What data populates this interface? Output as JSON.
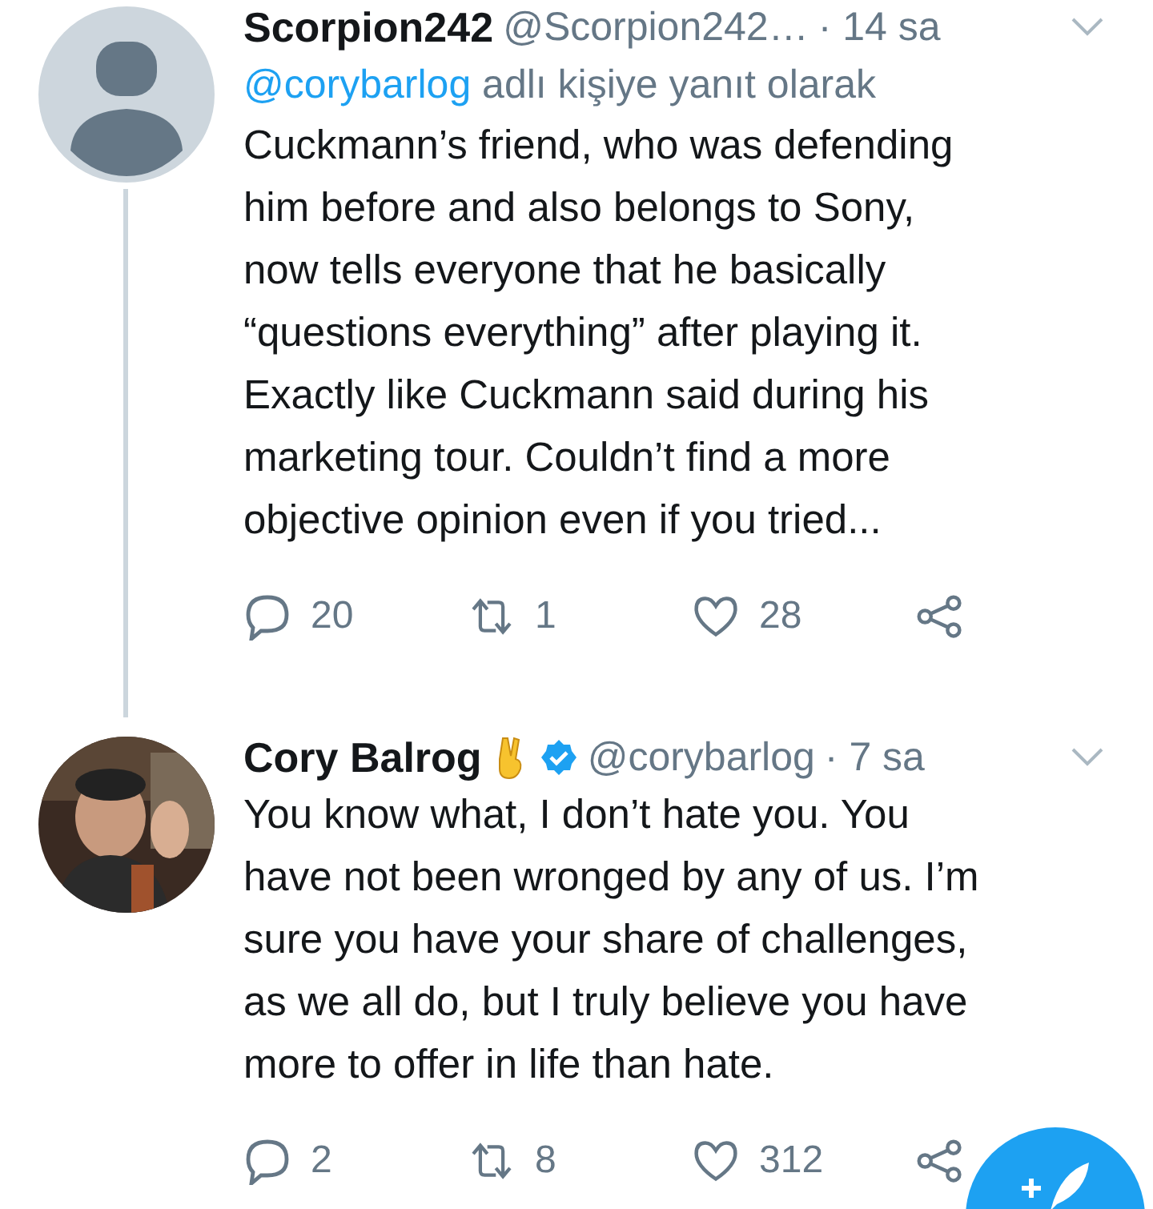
{
  "tweets": [
    {
      "name": "Scorpion242",
      "verified": false,
      "emoji": false,
      "handle": "@Scorpion242…",
      "time": "· 14 sa",
      "reply_prefix": "@corybarlog",
      "reply_suffix": " adlı kişiye yanıt olarak",
      "avatar": {
        "kind": "placeholder"
      },
      "body": "Cuckmann’s friend, who was defending\nhim before and also belongs to Sony,\nnow tells everyone that he basically\n“questions everything” after playing it.\nExactly like Cuckmann said during his\nmarketing tour. Couldn’t find a more\nobjective opinion even if you tried...",
      "replies": "20",
      "retweets": "1",
      "likes": "28",
      "thread_line": true
    },
    {
      "name": "Cory Balrog",
      "verified": true,
      "emoji": true,
      "handle": "@corybarlog",
      "time": "· 7 sa",
      "body": "You know what, I don’t hate you. You\nhave not been wronged by any of us.  I’m\nsure you have your share of challenges,\nas we all do, but I truly believe you have\nmore to offer in life than hate.",
      "replies": "2",
      "retweets": "8",
      "likes": "312",
      "thread_line": false
    }
  ],
  "fab": true
}
